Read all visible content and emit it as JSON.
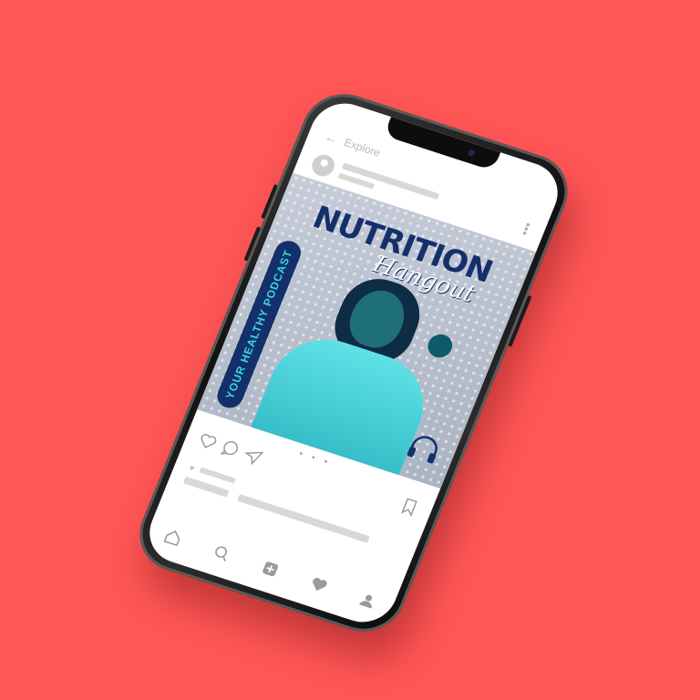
{
  "top_nav": {
    "back_label": "Explore"
  },
  "artwork": {
    "title": "NUTRITION",
    "subtitle": "Hangout",
    "tagline": "YOUR HEALTHY PODCAST",
    "carousel_dots": "• • •"
  },
  "colors": {
    "background": "#ff5656",
    "brand_navy": "#14306b",
    "accent_cyan": "#37d6e0"
  },
  "icons": {
    "top": [
      "back-arrow-icon",
      "more-icon"
    ],
    "actions": [
      "heart-icon",
      "comment-icon",
      "share-icon",
      "bookmark-icon"
    ],
    "bottom_nav": [
      "home-icon",
      "search-icon",
      "add-icon",
      "heart-icon",
      "profile-icon"
    ]
  }
}
